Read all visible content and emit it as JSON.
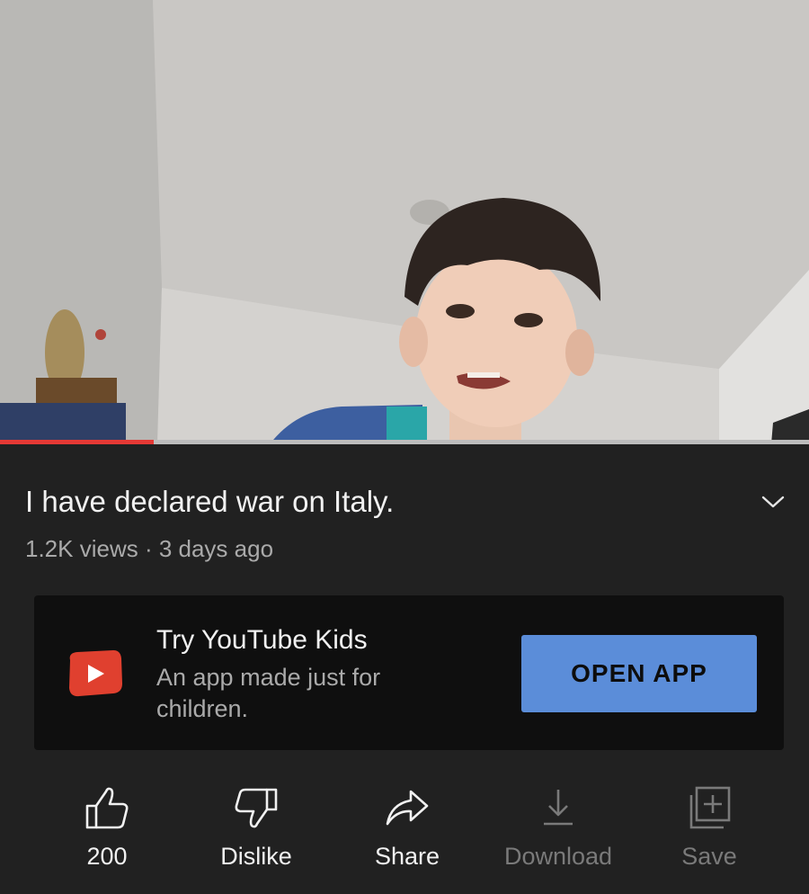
{
  "player": {
    "progress_fraction": 0.19,
    "progress_color": "#e53935"
  },
  "video": {
    "title": "I have declared war on Italy.",
    "meta": "1.2K views · 3 days ago"
  },
  "promo": {
    "title": "Try YouTube Kids",
    "subtitle": "An app made just for children.",
    "button_label": "OPEN APP",
    "logo_icon": "youtube-kids-logo-icon",
    "button_color": "#5b8dd9"
  },
  "actions": [
    {
      "label": "200",
      "icon": "thumbs-up-icon"
    },
    {
      "label": "Dislike",
      "icon": "thumbs-down-icon"
    },
    {
      "label": "Share",
      "icon": "share-arrow-icon"
    },
    {
      "label": "Download",
      "icon": "download-icon"
    },
    {
      "label": "Save",
      "icon": "save-to-playlist-icon"
    }
  ]
}
